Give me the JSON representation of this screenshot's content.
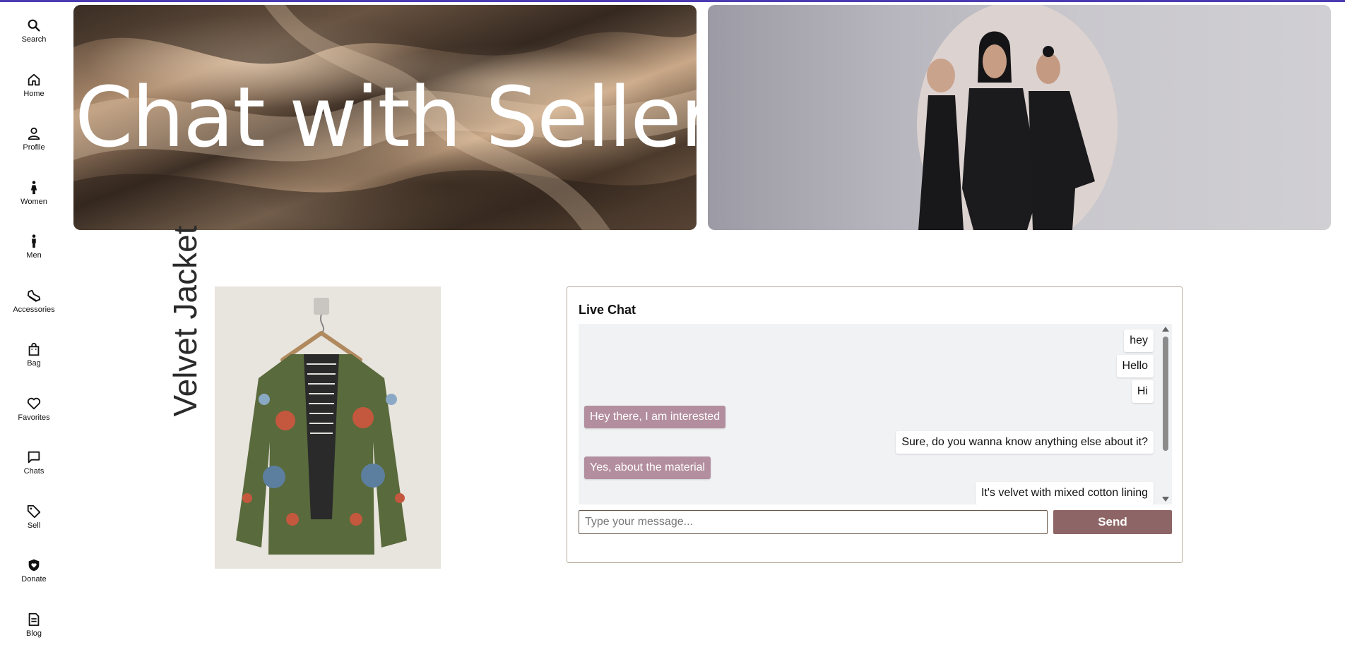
{
  "sidebar": {
    "items": [
      {
        "label": "Search",
        "icon": "search-icon"
      },
      {
        "label": "Home",
        "icon": "home-icon"
      },
      {
        "label": "Profile",
        "icon": "profile-icon"
      },
      {
        "label": "Women",
        "icon": "women-icon"
      },
      {
        "label": "Men",
        "icon": "men-icon"
      },
      {
        "label": "Accessories",
        "icon": "shoe-icon"
      },
      {
        "label": "Bag",
        "icon": "bag-icon"
      },
      {
        "label": "Favorites",
        "icon": "heart-icon"
      },
      {
        "label": "Chats",
        "icon": "chat-icon"
      },
      {
        "label": "Sell",
        "icon": "tag-icon"
      },
      {
        "label": "Donate",
        "icon": "shield-icon"
      },
      {
        "label": "Blog",
        "icon": "blog-icon"
      }
    ]
  },
  "banner": {
    "title": "Chat with Seller"
  },
  "product": {
    "title": "Velvet Jacket"
  },
  "chat": {
    "title": "Live Chat",
    "messages": [
      {
        "text": "hey",
        "side": "right"
      },
      {
        "text": "Hello",
        "side": "right"
      },
      {
        "text": "Hi",
        "side": "right"
      },
      {
        "text": "Hey there, I am interested",
        "side": "left"
      },
      {
        "text": "Sure, do you wanna know anything else about it?",
        "side": "right"
      },
      {
        "text": "Yes, about the material",
        "side": "left"
      },
      {
        "text": "It's velvet with mixed cotton lining",
        "side": "right"
      }
    ],
    "input_placeholder": "Type your message...",
    "input_value": "",
    "send_label": "Send"
  },
  "colors": {
    "accent": "#4b3bb3",
    "send_button": "#8e6566",
    "buyer_bubble": "#b38e9e",
    "chat_background": "#f1f2f4"
  }
}
